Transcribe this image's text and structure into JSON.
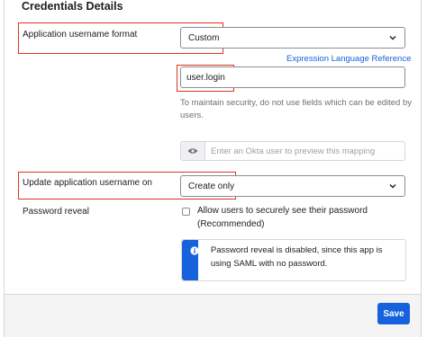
{
  "section": {
    "title": "Credentials Details"
  },
  "username_format": {
    "label": "Application username format",
    "selected": "Custom"
  },
  "expression_link": "Expression Language Reference",
  "expression_input": {
    "value": "user.login"
  },
  "help_text": "To maintain security, do not use fields which can be edited by users.",
  "preview": {
    "placeholder": "Enter an Okta user to preview this mapping"
  },
  "update_username": {
    "label": "Update application username on",
    "selected": "Create only"
  },
  "password_reveal": {
    "label": "Password reveal",
    "checkbox_label": "Allow users to securely see their password (Recommended)",
    "checked": false
  },
  "info_message": "Password reveal is disabled, since this app is using SAML with no password.",
  "footer": {
    "save_label": "Save"
  },
  "colors": {
    "accent": "#1662dd",
    "highlight": "#e0341c"
  },
  "icons": [
    "chevron-down-icon",
    "eye-icon",
    "info-icon"
  ]
}
